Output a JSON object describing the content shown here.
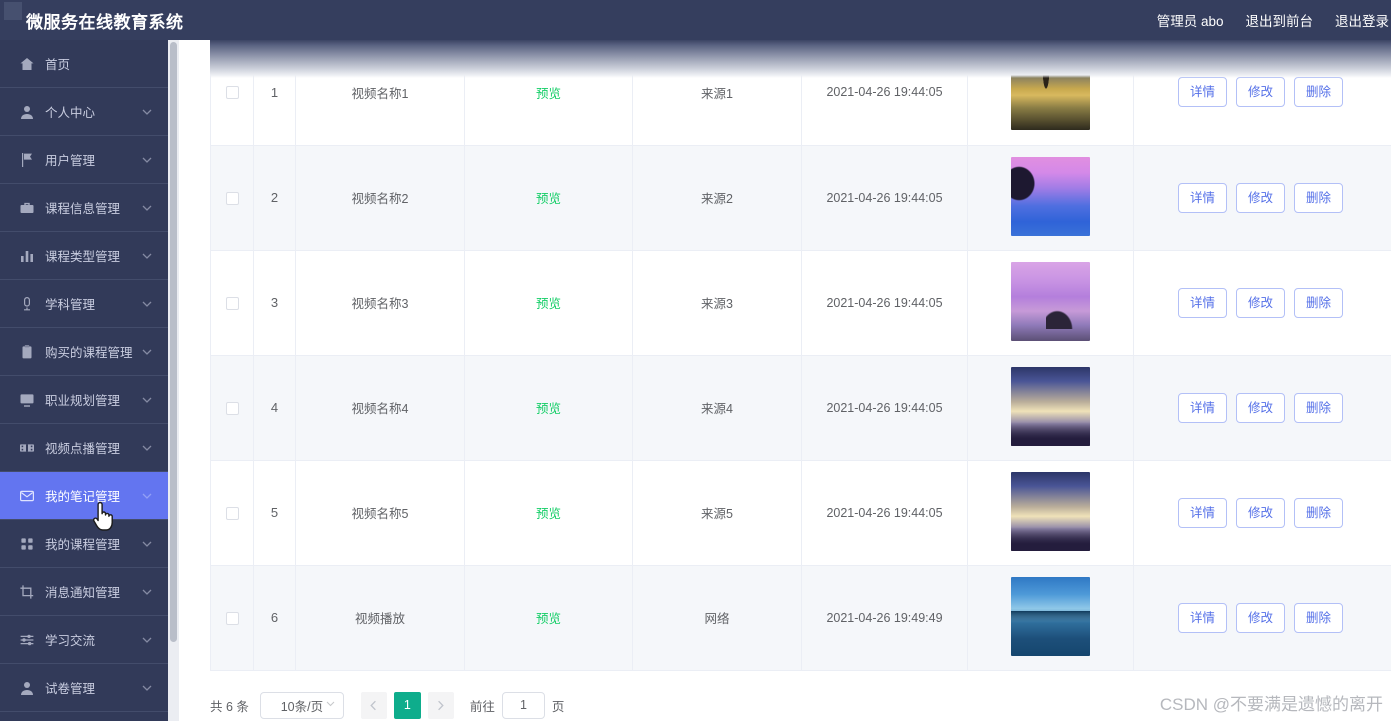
{
  "header": {
    "title": "微服务在线教育系统",
    "logo_icon": "app-logo-icon",
    "right_items": [
      {
        "label": "管理员 abo",
        "name": "current-user"
      },
      {
        "label": "退出到前台",
        "name": "exit-to-frontend"
      },
      {
        "label": "退出登录",
        "name": "logout"
      }
    ]
  },
  "sidebar": {
    "items": [
      {
        "label": "首页",
        "icon": "home-icon",
        "has_chevron": false,
        "active": false
      },
      {
        "label": "个人中心",
        "icon": "user-icon",
        "has_chevron": true,
        "active": false
      },
      {
        "label": "用户管理",
        "icon": "flag-icon",
        "has_chevron": true,
        "active": false
      },
      {
        "label": "课程信息管理",
        "icon": "briefcase-icon",
        "has_chevron": true,
        "active": false
      },
      {
        "label": "课程类型管理",
        "icon": "bar-chart-icon",
        "has_chevron": true,
        "active": false
      },
      {
        "label": "学科管理",
        "icon": "microphone-icon",
        "has_chevron": true,
        "active": false
      },
      {
        "label": "购买的课程管理",
        "icon": "clipboard-icon",
        "has_chevron": true,
        "active": false
      },
      {
        "label": "职业规划管理",
        "icon": "monitor-icon",
        "has_chevron": true,
        "active": false
      },
      {
        "label": "视频点播管理",
        "icon": "film-icon",
        "has_chevron": true,
        "active": false
      },
      {
        "label": "我的笔记管理",
        "icon": "envelope-icon",
        "has_chevron": true,
        "active": true
      },
      {
        "label": "我的课程管理",
        "icon": "grid-icon",
        "has_chevron": true,
        "active": false
      },
      {
        "label": "消息通知管理",
        "icon": "crop-icon",
        "has_chevron": true,
        "active": false
      },
      {
        "label": "学习交流",
        "icon": "sliders-icon",
        "has_chevron": true,
        "active": false
      },
      {
        "label": "试卷管理",
        "icon": "person-icon",
        "has_chevron": true,
        "active": false
      }
    ]
  },
  "table": {
    "preview_label": "预览",
    "ops": {
      "detail": "详情",
      "edit": "修改",
      "delete": "删除"
    },
    "rows": [
      {
        "index": "1",
        "name": "视频名称1",
        "source": "来源1",
        "time": "2021-04-26 19:44:05",
        "thumb": "th1"
      },
      {
        "index": "2",
        "name": "视频名称2",
        "source": "来源2",
        "time": "2021-04-26 19:44:05",
        "thumb": "th2"
      },
      {
        "index": "3",
        "name": "视频名称3",
        "source": "来源3",
        "time": "2021-04-26 19:44:05",
        "thumb": "th3"
      },
      {
        "index": "4",
        "name": "视频名称4",
        "source": "来源4",
        "time": "2021-04-26 19:44:05",
        "thumb": "th4"
      },
      {
        "index": "5",
        "name": "视频名称5",
        "source": "来源5",
        "time": "2021-04-26 19:44:05",
        "thumb": "th5"
      },
      {
        "index": "6",
        "name": "视频播放",
        "source": "网络",
        "time": "2021-04-26 19:49:49",
        "thumb": "th6"
      }
    ]
  },
  "pagination": {
    "total_label": "共 6 条",
    "page_size": "10条/页",
    "prev_icon": "chevron-left-icon",
    "next_icon": "chevron-right-icon",
    "current_page": "1",
    "goto_label": "前往",
    "goto_value": "1",
    "page_unit": "页"
  },
  "watermark": {
    "text": "CSDN @不要满是遗憾的离开"
  },
  "colors": {
    "header_bg": "#353e5e",
    "sidebar_bg": "#323a59",
    "active_item": "#6375f0",
    "preview_green": "#13ce66",
    "pager_green": "#0ead8c",
    "button_blue": "#5570e8"
  }
}
